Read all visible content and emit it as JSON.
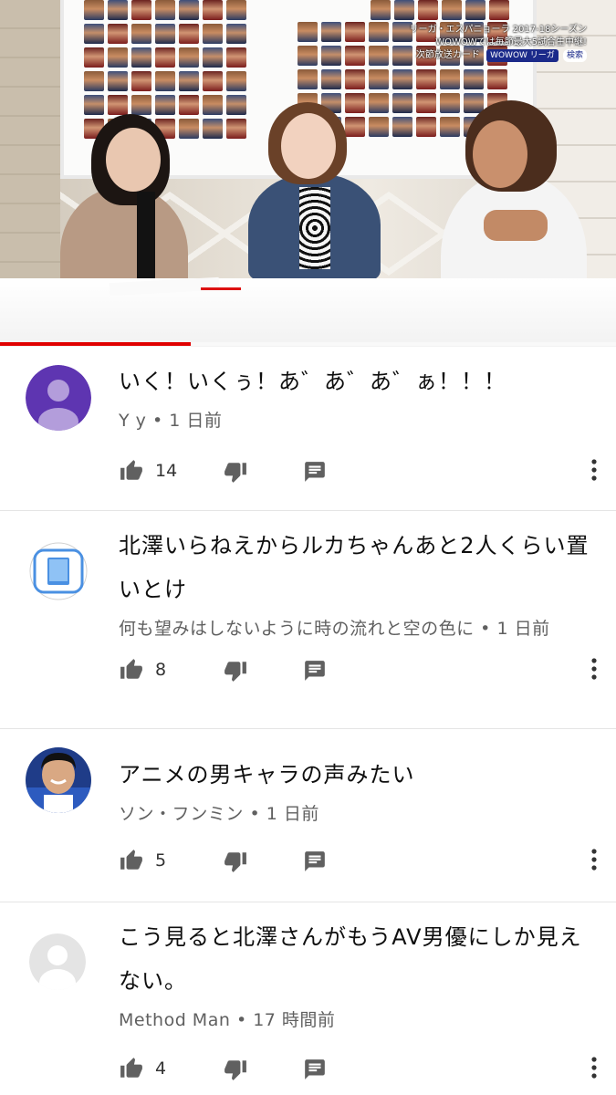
{
  "video": {
    "overlay": {
      "line1": "リーガ・エスパニョーラ 2017-18シーズン",
      "line2": "WOWOWでは毎節最大5試合生中継!",
      "line3": "次節放送カード",
      "badge1": "WOWOW リーガ",
      "badge2": "検索"
    },
    "progress_fraction": 0.31,
    "progress_color": "#e00000"
  },
  "comments": [
    {
      "text": "いく！いくぅ！あ゛あ゛あ゛ぁ！！！",
      "author": "Y y",
      "time": "1 日前",
      "likes": "14",
      "avatar": {
        "type": "default-person",
        "color": "#5e35b1"
      }
    },
    {
      "text": "北澤いらねえからルカちゃんあと2人くらい置いとけ",
      "author": "何も望みはしないように時の流れと空の色に",
      "time": "1 日前",
      "likes": "8",
      "avatar": {
        "type": "phone-icon",
        "color": "#4a90e2"
      }
    },
    {
      "text": "アニメの男キャラの声みたい",
      "author": "ソン・フンミン",
      "time": "1 日前",
      "likes": "5",
      "avatar": {
        "type": "photo",
        "color": "#1f3c88"
      }
    },
    {
      "text": "こう見ると北澤さんがもうAV男優にしか見えない。",
      "author": "Method Man",
      "time": "17 時間前",
      "likes": "4",
      "avatar": {
        "type": "default-gray",
        "color": "#bdbdbd"
      }
    }
  ],
  "ui": {
    "separator": "•",
    "icons": [
      "thumb-up-icon",
      "thumb-down-icon",
      "reply-icon",
      "more-vert-icon"
    ]
  }
}
